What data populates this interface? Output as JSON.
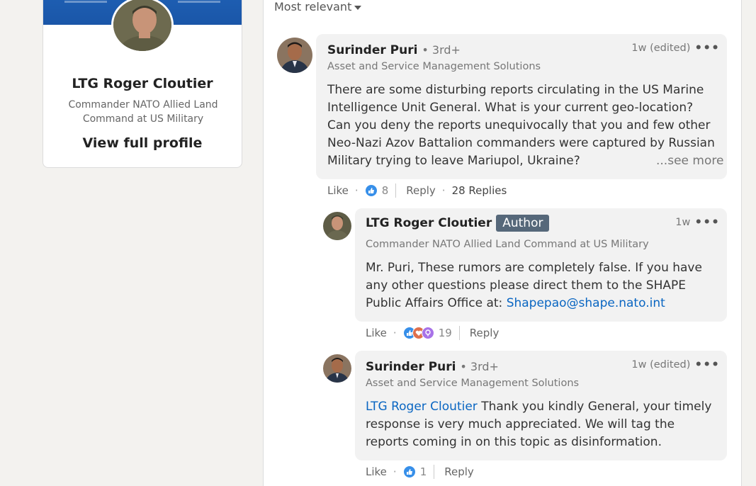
{
  "sort": {
    "label": "Most relevant"
  },
  "profile": {
    "name": "LTG Roger Cloutier",
    "headline": "Commander NATO Allied Land Command at US Military",
    "view_profile": "View full profile"
  },
  "colors": {
    "link": "#0a66c2",
    "author_badge": "#56687a",
    "like": "#378fe9",
    "love": "#df704d",
    "curious": "#a872e8"
  },
  "comments": [
    {
      "author": "Surinder Puri",
      "degree": "• 3rd+",
      "headline": "Asset and Service Management Solutions",
      "time": "1w (edited)",
      "text": "There are some disturbing reports circulating in the US Marine Intelligence Unit General. What is your current geo-location? Can you deny the reports unequivocally that you and few other Neo-Nazi Azov Battalion commanders were captured by Russian Military trying to leave Mariupol, Ukraine?",
      "see_more": "...see more",
      "like_label": "Like",
      "reaction_count": "8",
      "reaction_icons": [
        "like-icon"
      ],
      "reply_label": "Reply",
      "replies": "28 Replies"
    },
    {
      "author": "LTG Roger Cloutier",
      "badge": "Author",
      "headline": "Commander NATO Allied Land Command at US Military",
      "time": "1w",
      "text_pre": "Mr. Puri, These rumors are completely false. If you have any other questions please direct them to the SHAPE Public Affairs Office at: ",
      "text_link": "Shapepao@shape.nato.int",
      "like_label": "Like",
      "reaction_count": "19",
      "reaction_icons": [
        "like-icon",
        "love-icon",
        "curious-icon"
      ],
      "reply_label": "Reply"
    },
    {
      "author": "Surinder Puri",
      "degree": "• 3rd+",
      "headline": "Asset and Service Management Solutions",
      "time": "1w (edited)",
      "mention": "LTG Roger Cloutier",
      "text": " Thank you kindly General, your timely response is very much appreciated. We will tag the reports coming in on this topic as disinformation.",
      "like_label": "Like",
      "reaction_count": "1",
      "reaction_icons": [
        "like-icon"
      ],
      "reply_label": "Reply"
    }
  ]
}
